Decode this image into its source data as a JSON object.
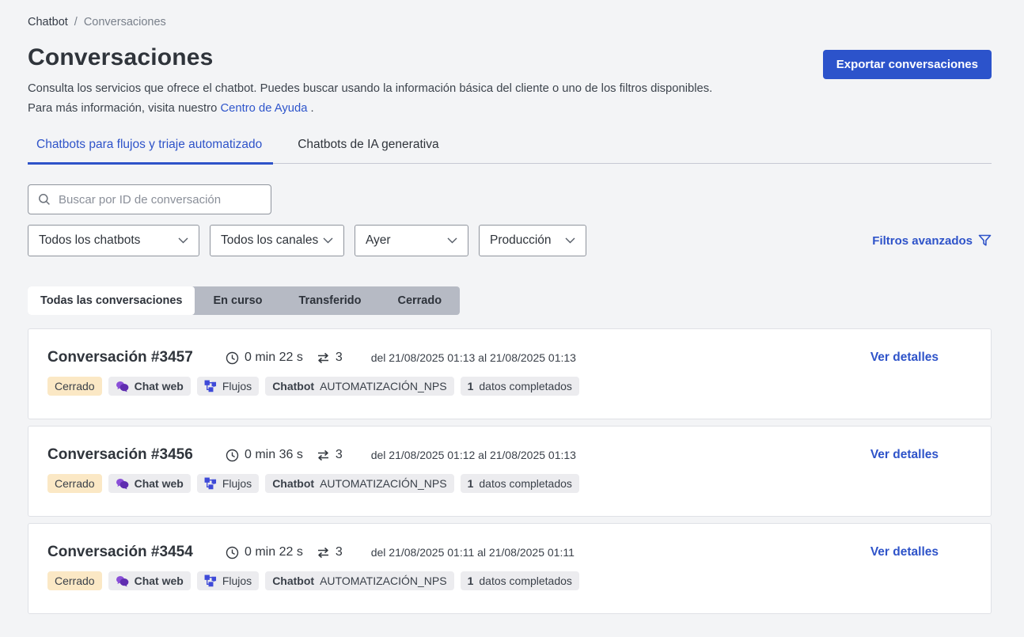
{
  "colors": {
    "accent_blue": "#2c53cb",
    "link_blue": "#2e53c9",
    "page_background": "#f3f4f6",
    "badge_closed_bg": "#fbe8c5",
    "badge_gray_bg": "#ececef",
    "segmented_bg": "#b6bac4",
    "chat_icon_purple": "#7a3bd0",
    "flow_icon_indigo": "#3f4ad8"
  },
  "breadcrumb": {
    "root": "Chatbot",
    "separator": "/",
    "current": "Conversaciones"
  },
  "header": {
    "title": "Conversaciones",
    "export_button_label": "Exportar conversaciones",
    "description_before_link": "Consulta los servicios que ofrece el chatbot. Puedes buscar usando la información básica del cliente o uno de los filtros disponibles. Para más información, visita nuestro",
    "help_link_label": "Centro de Ayuda",
    "description_after_link": "."
  },
  "tabs": {
    "flows_label": "Chatbots para flujos y triaje automatizado",
    "generative_label": "Chatbots de IA generativa"
  },
  "filters": {
    "search_placeholder": "Buscar por ID de conversación",
    "chatbot_filter_value": "Todos los chatbots",
    "channel_filter_value": "Todos los canales",
    "date_filter_value": "Ayer",
    "environment_filter_value": "Producción",
    "advanced_filters_label": "Filtros avanzados"
  },
  "status_tabs": {
    "all_label": "Todas las conversaciones",
    "in_progress_label": "En curso",
    "transferred_label": "Transferido",
    "closed_label": "Cerrado"
  },
  "conversations": [
    {
      "title": "Conversación #3457",
      "duration": "0 min 22 s",
      "exchanges": "3",
      "date_range": "del 21/08/2025 01:13 al 21/08/2025 01:13",
      "status": "Cerrado",
      "channel": "Chat web",
      "type": "Flujos",
      "chatbot_label": "Chatbot",
      "chatbot_name": "AUTOMATIZACIÓN_NPS",
      "data_count": "1",
      "data_label": "datos completados",
      "details_label": "Ver detalles"
    },
    {
      "title": "Conversación #3456",
      "duration": "0 min 36 s",
      "exchanges": "3",
      "date_range": "del 21/08/2025 01:12 al 21/08/2025 01:13",
      "status": "Cerrado",
      "channel": "Chat web",
      "type": "Flujos",
      "chatbot_label": "Chatbot",
      "chatbot_name": "AUTOMATIZACIÓN_NPS",
      "data_count": "1",
      "data_label": "datos completados",
      "details_label": "Ver detalles"
    },
    {
      "title": "Conversación #3454",
      "duration": "0 min 22 s",
      "exchanges": "3",
      "date_range": "del 21/08/2025 01:11 al 21/08/2025 01:11",
      "status": "Cerrado",
      "channel": "Chat web",
      "type": "Flujos",
      "chatbot_label": "Chatbot",
      "chatbot_name": "AUTOMATIZACIÓN_NPS",
      "data_count": "1",
      "data_label": "datos completados",
      "details_label": "Ver detalles"
    }
  ]
}
